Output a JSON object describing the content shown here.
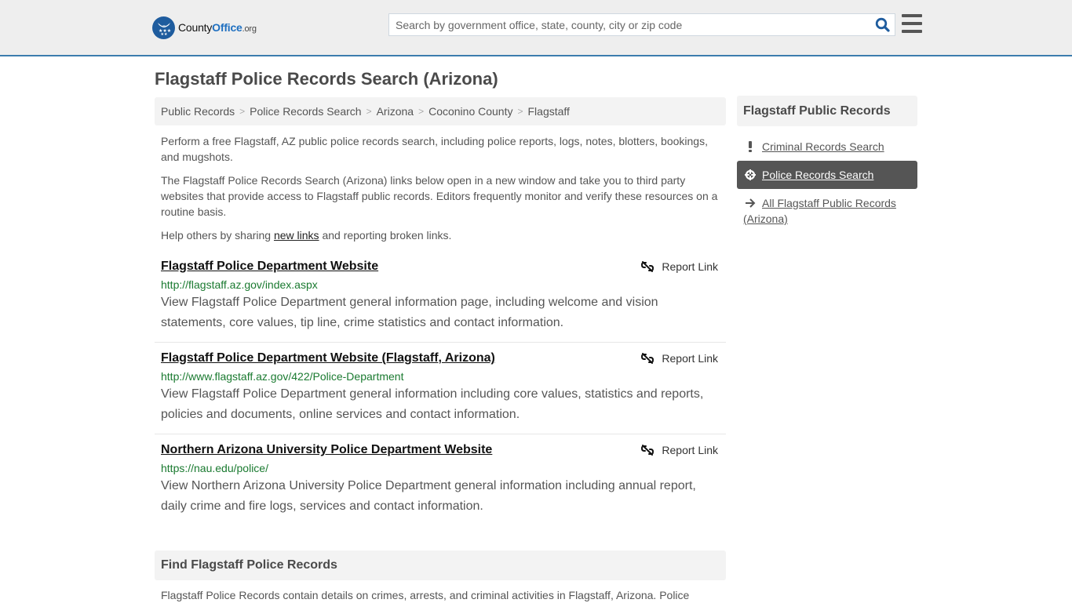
{
  "header": {
    "logo": {
      "part1": "County",
      "part2": "Office",
      "part3": ".org"
    },
    "search_placeholder": "Search by government office, state, county, city or zip code",
    "search_icon": "search-icon",
    "menu_icon": "hamburger-menu-icon"
  },
  "page_title": "Flagstaff Police Records Search (Arizona)",
  "breadcrumb": [
    "Public Records",
    "Police Records Search",
    "Arizona",
    "Coconino County",
    "Flagstaff"
  ],
  "intro": {
    "p1": "Perform a free Flagstaff, AZ public police records search, including police reports, logs, notes, blotters, bookings, and mugshots.",
    "p2": "The Flagstaff Police Records Search (Arizona) links below open in a new window and take you to third party websites that provide access to Flagstaff public records. Editors frequently monitor and verify these resources on a routine basis.",
    "p3_before": "Help others by sharing ",
    "p3_link": "new links",
    "p3_after": " and reporting broken links."
  },
  "results": [
    {
      "title": "Flagstaff Police Department Website",
      "url": "http://flagstaff.az.gov/index.aspx",
      "description": "View Flagstaff Police Department general information page, including welcome and vision statements, core values, tip line, crime statistics and contact information.",
      "report_label": "Report Link"
    },
    {
      "title": "Flagstaff Police Department Website (Flagstaff, Arizona)",
      "url": "http://www.flagstaff.az.gov/422/Police-Department",
      "description": "View Flagstaff Police Department general information including core values, statistics and reports, policies and documents, online services and contact information.",
      "report_label": "Report Link"
    },
    {
      "title": "Northern Arizona University Police Department Website",
      "url": "https://nau.edu/police/",
      "description": "View Northern Arizona University Police Department general information including annual report, daily crime and fire logs, services and contact information.",
      "report_label": "Report Link"
    }
  ],
  "find_section": {
    "title": "Find Flagstaff Police Records",
    "text": "Flagstaff Police Records contain details on crimes, arrests, and criminal activities in Flagstaff, Arizona. Police"
  },
  "sidebar": {
    "title": "Flagstaff Public Records",
    "items": [
      {
        "label": "Criminal Records Search",
        "icon": "exclamation-icon",
        "active": false
      },
      {
        "label": "Police Records Search",
        "icon": "crosshairs-icon",
        "active": true
      },
      {
        "label": "All Flagstaff Public Records (Arizona)",
        "icon": "arrow-right-icon",
        "active": false
      }
    ]
  },
  "colors": {
    "accent_blue": "#3c7cae",
    "logo_blue": "#1e5c9e",
    "url_green": "#1a7a30",
    "active_bg": "#555555"
  }
}
